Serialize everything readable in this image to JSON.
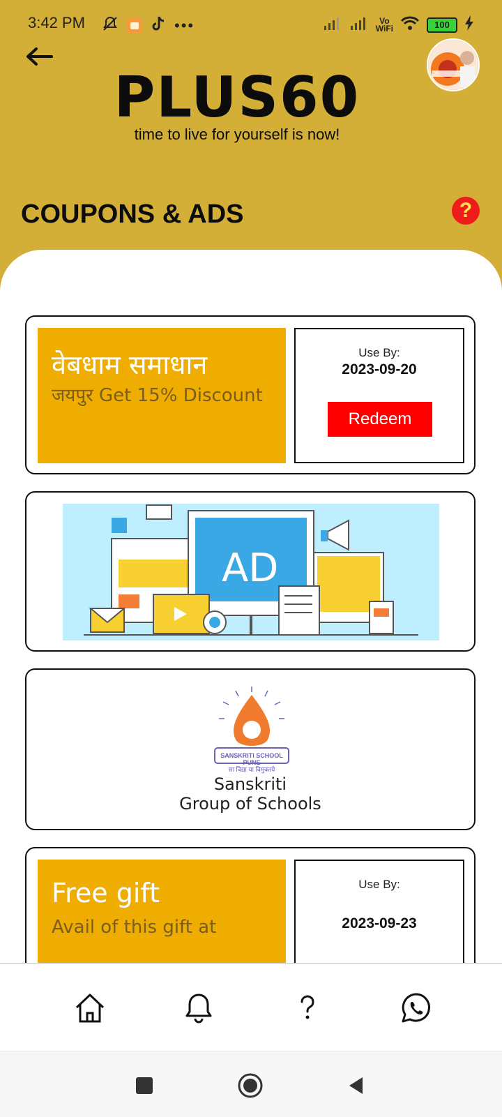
{
  "status_bar": {
    "time": "3:42 PM",
    "battery": "100"
  },
  "header": {
    "brand_name": "PLUS60",
    "tagline": "time to live for yourself is now!",
    "page_title": "COUPONS & ADS",
    "help_label": "?"
  },
  "coupons": [
    {
      "title": "वेबधाम समाधान",
      "subtitle": "जयपुर  Get 15% Discount",
      "use_by_label": "Use By:",
      "date": "2023-09-20",
      "redeem_label": "Redeem"
    },
    {
      "title": "Free gift",
      "subtitle": "Avail of this gift at",
      "use_by_label": "Use By:",
      "date": "2023-09-23"
    }
  ],
  "ads": {
    "banner_text": "AD",
    "school_line1": "Sanskriti",
    "school_line2": "Group of Schools",
    "school_seal_text": "SANSKRITI SCHOOL PUNE",
    "school_motto": "सा विद्या या विमुक्तये"
  },
  "bottom_nav": {
    "items": [
      "home-icon",
      "bell-icon",
      "question-icon",
      "whatsapp-icon"
    ]
  },
  "colors": {
    "header_bg": "#D4AF37",
    "coupon_bg": "#EEAD00",
    "redeem_bg": "#FF0000",
    "help_bg": "#EF1C1C"
  }
}
